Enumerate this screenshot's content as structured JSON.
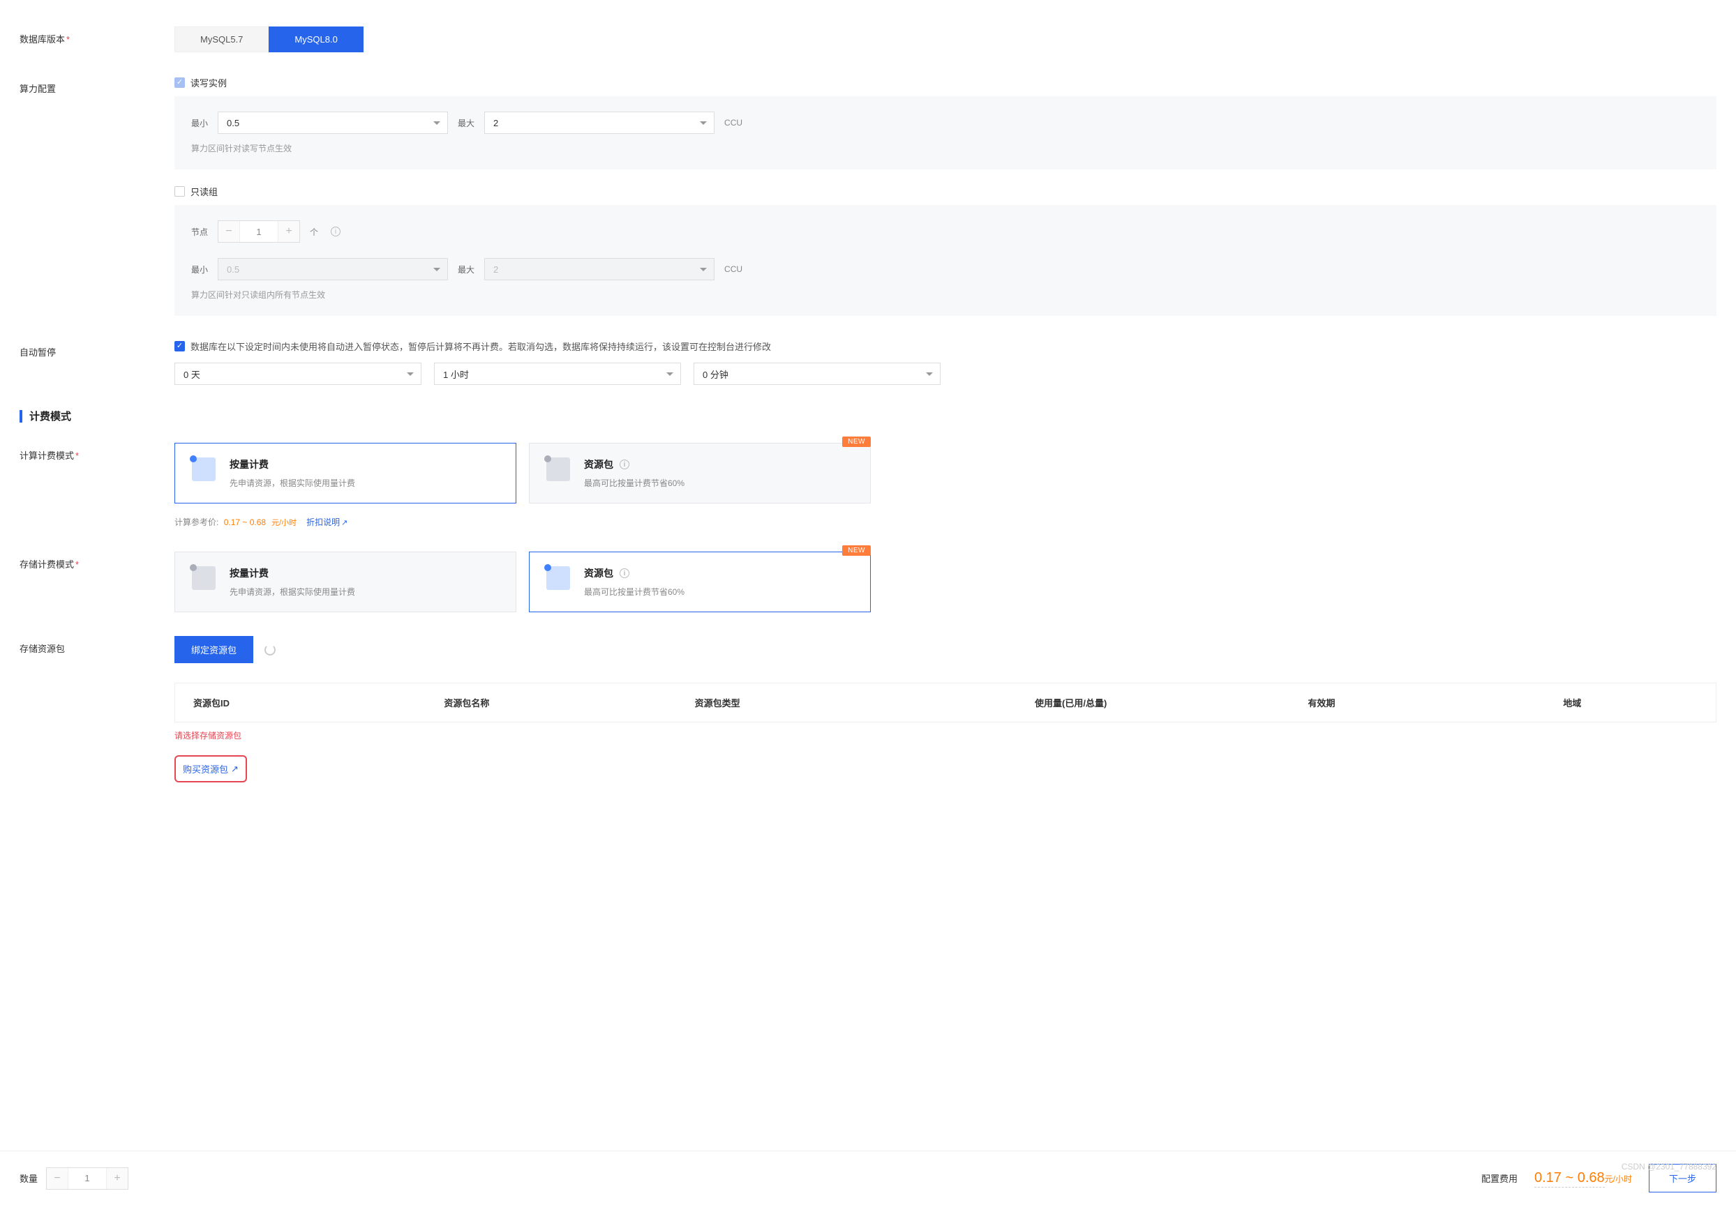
{
  "db_version": {
    "label": "数据库版本",
    "options": [
      "MySQL5.7",
      "MySQL8.0"
    ],
    "active_index": 1
  },
  "compute": {
    "label": "算力配置",
    "rw_instance": "读写实例",
    "min_label": "最小",
    "max_label": "最大",
    "rw_min": "0.5",
    "rw_max": "2",
    "unit": "CCU",
    "rw_hint": "算力区间针对读写节点生效",
    "ro_group": "只读组",
    "node_label": "节点",
    "node_count": "1",
    "node_unit": "个",
    "ro_min": "0.5",
    "ro_max": "2",
    "ro_hint": "算力区间针对只读组内所有节点生效"
  },
  "auto_pause": {
    "label": "自动暂停",
    "desc": "数据库在以下设定时间内未使用将自动进入暂停状态，暂停后计算将不再计费。若取消勾选，数据库将保持持续运行，该设置可在控制台进行修改",
    "days": "0 天",
    "hours": "1 小时",
    "minutes": "0 分钟"
  },
  "billing_section": "计费模式",
  "compute_billing": {
    "label": "计算计费模式",
    "opt1_title": "按量计费",
    "opt1_desc": "先申请资源，根据实际使用量计费",
    "opt2_title": "资源包",
    "opt2_desc": "最高可比按量计费节省60%",
    "new_badge": "NEW",
    "price_prefix": "计算参考价:",
    "price": "0.17 ~ 0.68",
    "price_unit": "元/小时",
    "discount_link": "折扣说明"
  },
  "storage_billing": {
    "label": "存储计费模式",
    "opt1_title": "按量计费",
    "opt1_desc": "先申请资源，根据实际使用量计费",
    "opt2_title": "资源包",
    "opt2_desc": "最高可比按量计费节省60%",
    "new_badge": "NEW"
  },
  "storage_pkg": {
    "label": "存储资源包",
    "bind_btn": "绑定资源包",
    "table_headers": {
      "id": "资源包ID",
      "name": "资源包名称",
      "type": "资源包类型",
      "usage": "使用量(已用/总量)",
      "validity": "有效期",
      "region": "地域"
    },
    "error": "请选择存储资源包",
    "buy_link": "购买资源包"
  },
  "footer": {
    "qty_label": "数量",
    "qty": "1",
    "cost_label": "配置费用",
    "cost_val": "0.17 ~ 0.68",
    "cost_unit": "元/小时",
    "next_btn": "下一步"
  },
  "watermark": "CSDN @2301_77888392"
}
